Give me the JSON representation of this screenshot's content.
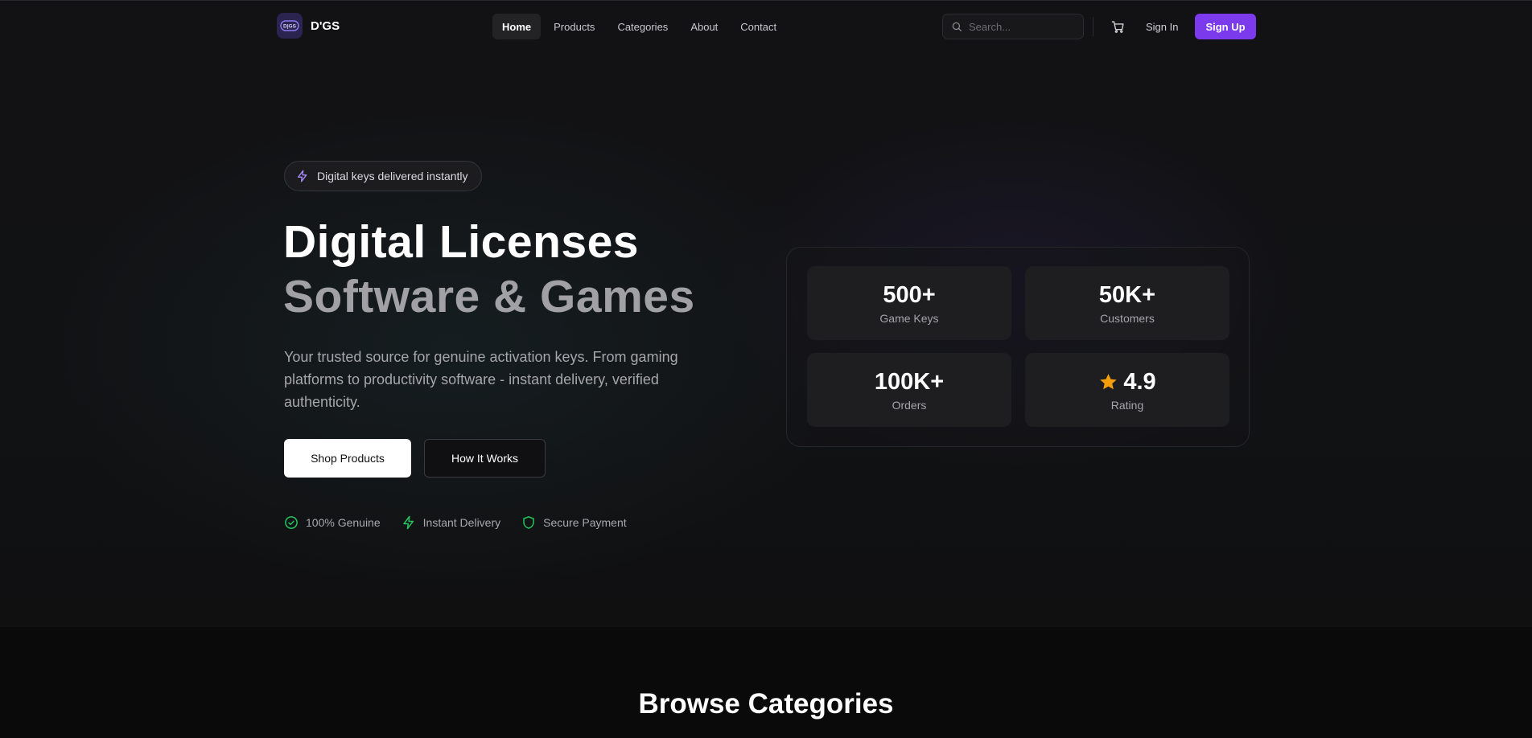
{
  "nav": {
    "logo_badge": "D|GS",
    "brand": "D'GS",
    "items": [
      {
        "label": "Home",
        "active": true
      },
      {
        "label": "Products",
        "active": false
      },
      {
        "label": "Categories",
        "active": false
      },
      {
        "label": "About",
        "active": false
      },
      {
        "label": "Contact",
        "active": false
      }
    ],
    "search_placeholder": "Search...",
    "sign_in": "Sign In",
    "sign_up": "Sign Up"
  },
  "hero": {
    "badge": "Digital keys delivered instantly",
    "title_line1": "Digital Licenses",
    "title_line2": "Software & Games",
    "description": "Your trusted source for genuine activation keys. From gaming platforms to productivity software - instant delivery, verified authenticity.",
    "primary_button": "Shop Products",
    "secondary_button": "How It Works",
    "trust": [
      {
        "icon": "check-circle-icon",
        "label": "100% Genuine"
      },
      {
        "icon": "lightning-icon",
        "label": "Instant Delivery"
      },
      {
        "icon": "shield-icon",
        "label": "Secure Payment"
      }
    ]
  },
  "stats": [
    {
      "value": "500+",
      "label": "Game Keys"
    },
    {
      "value": "50K+",
      "label": "Customers"
    },
    {
      "value": "100K+",
      "label": "Orders"
    },
    {
      "value": "4.9",
      "label": "Rating",
      "icon": "star-icon"
    }
  ],
  "sections": {
    "categories_title": "Browse Categories"
  },
  "colors": {
    "accent": "#7c3aed",
    "success": "#22c55e",
    "star": "#f59e0b",
    "background": "#0b0b0c"
  }
}
